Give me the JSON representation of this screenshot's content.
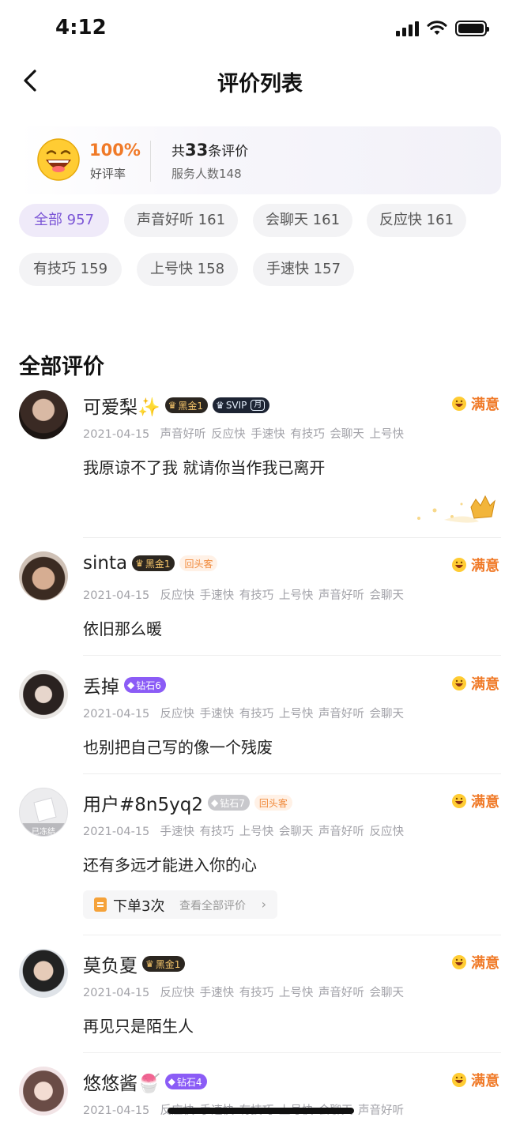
{
  "status_bar": {
    "time": "4:12"
  },
  "nav": {
    "title": "评价列表"
  },
  "summary": {
    "rate": "100%",
    "rate_label": "好评率",
    "total_prefix": "共",
    "total_count": "33",
    "total_suffix": "条评价",
    "served": "服务人数148"
  },
  "tags": [
    {
      "label": "全部 957",
      "active": true
    },
    {
      "label": "声音好听 161",
      "active": false
    },
    {
      "label": "会聊天 161",
      "active": false
    },
    {
      "label": "反应快 161",
      "active": false
    },
    {
      "label": "有技巧 159",
      "active": false
    },
    {
      "label": "上号快 158",
      "active": false
    },
    {
      "label": "手速快 157",
      "active": false
    }
  ],
  "section_title": "全部评价",
  "satisfied_label": "满意",
  "reviews": [
    {
      "name": "可爱梨✨",
      "badges": [
        {
          "type": "gold",
          "text": "黑金1"
        },
        {
          "type": "svip",
          "text": "SVIP",
          "sub": "月"
        }
      ],
      "date": "2021-04-15",
      "tags": "声音好听 反应快 手速快 有技巧 会聊天 上号快",
      "content": "我原谅不了我 就请你当作我已离开"
    },
    {
      "name": "sinta",
      "badges": [
        {
          "type": "gold",
          "text": "黑金1"
        },
        {
          "type": "return",
          "text": "回头客"
        }
      ],
      "date": "2021-04-15",
      "tags": "反应快 手速快 有技巧 上号快 声音好听 会聊天",
      "content": "依旧那么暖"
    },
    {
      "name": "丢掉",
      "badges": [
        {
          "type": "diamond",
          "text": "钻石6"
        }
      ],
      "date": "2021-04-15",
      "tags": "反应快 手速快 有技巧 上号快 声音好听 会聊天",
      "content": "也别把自己写的像一个残废"
    },
    {
      "name": "用户#8n5yq2",
      "badges": [
        {
          "type": "diamond-gray",
          "text": "钻石7"
        },
        {
          "type": "return",
          "text": "回头客"
        }
      ],
      "date": "2021-04-15",
      "tags": "手速快 有技巧 上号快 会聊天 声音好听 反应快",
      "content": "还有多远才能进入你的心",
      "avatar_label": "已冻结",
      "order": {
        "count": "下单3次",
        "link": "查看全部评价"
      }
    },
    {
      "name": "莫负夏",
      "badges": [
        {
          "type": "gold",
          "text": "黑金1"
        }
      ],
      "date": "2021-04-15",
      "tags": "反应快 手速快 有技巧 上号快 声音好听 会聊天",
      "content": "再见只是陌生人"
    },
    {
      "name": "悠悠酱🍧",
      "badges": [
        {
          "type": "diamond",
          "text": "钻石4"
        }
      ],
      "date": "2021-04-15",
      "tags": "反应快 手速快 有技巧 上号快 会聊天 声音好听",
      "content": ""
    }
  ],
  "colors": {
    "accent_orange": "#f07a28",
    "tag_active": "#7b55d6",
    "diamond": "#8b5cf6"
  }
}
